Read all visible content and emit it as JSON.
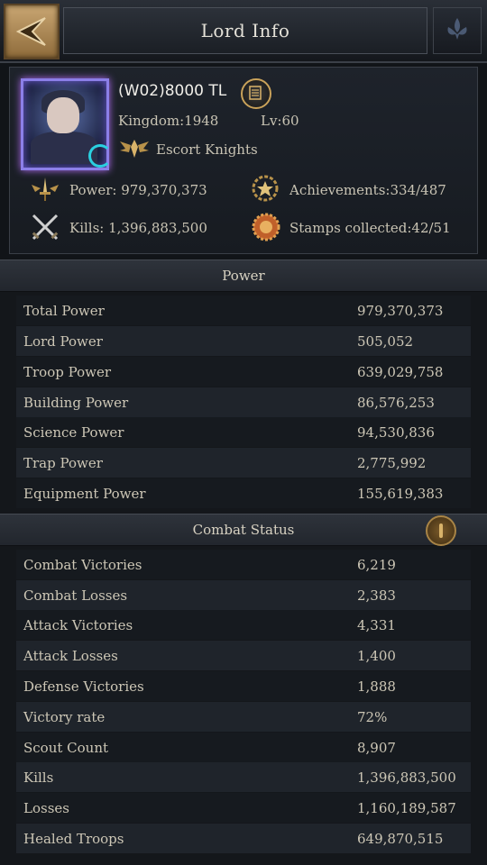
{
  "header": {
    "title": "Lord Info",
    "back_icon": "back-arrow-icon",
    "emblem_icon": "fleur-de-lis-icon"
  },
  "profile": {
    "name": "(W02)8000 TL",
    "kingdom": "Kingdom:1948",
    "level": "Lv:60",
    "rank": "Escort Knights",
    "power": "Power: 979,370,373",
    "achievements": "Achievements:334/487",
    "kills": "Kills: 1,396,883,500",
    "stamps": "Stamps collected:42/51"
  },
  "power_section": {
    "title": "Power",
    "rows": [
      {
        "label": "Total Power",
        "value": "979,370,373"
      },
      {
        "label": "Lord Power",
        "value": "505,052"
      },
      {
        "label": "Troop Power",
        "value": "639,029,758"
      },
      {
        "label": "Building Power",
        "value": "86,576,253"
      },
      {
        "label": "Science Power",
        "value": "94,530,836"
      },
      {
        "label": "Trap Power",
        "value": "2,775,992"
      },
      {
        "label": "Equipment Power",
        "value": "155,619,383"
      }
    ]
  },
  "combat_section": {
    "title": "Combat Status",
    "rows": [
      {
        "label": "Combat Victories",
        "value": "6,219"
      },
      {
        "label": "Combat Losses",
        "value": "2,383"
      },
      {
        "label": "Attack Victories",
        "value": "4,331"
      },
      {
        "label": "Attack Losses",
        "value": "1,400"
      },
      {
        "label": "Defense Victories",
        "value": "1,888"
      },
      {
        "label": "Victory rate",
        "value": "72%"
      },
      {
        "label": "Scout Count",
        "value": "8,907"
      },
      {
        "label": "Kills",
        "value": "1,396,883,500"
      },
      {
        "label": "Losses",
        "value": "1,160,189,587"
      },
      {
        "label": "Healed Troops",
        "value": "649,870,515"
      }
    ]
  },
  "colors": {
    "accent_gold": "#c9a25a",
    "text": "#cdc7b6",
    "background": "#111418"
  }
}
